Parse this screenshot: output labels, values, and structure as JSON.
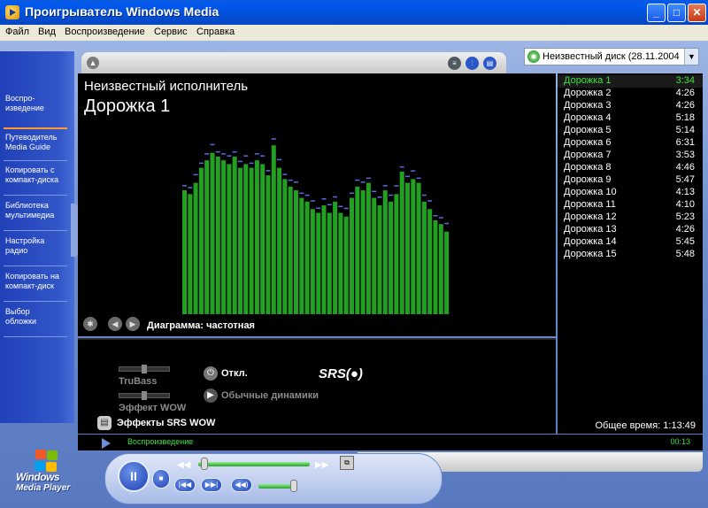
{
  "window": {
    "title": "Проигрыватель Windows Media",
    "minimize_icon": "minimize-icon",
    "maximize_icon": "maximize-icon",
    "close_icon": "close-icon"
  },
  "menu": [
    {
      "label": "Файл"
    },
    {
      "label": "Вид"
    },
    {
      "label": "Воспроизведение"
    },
    {
      "label": "Сервис"
    },
    {
      "label": "Справка"
    }
  ],
  "taskbar": [
    {
      "label": "Воспро-\nизведение",
      "active": true
    },
    {
      "label": "Путеводитель\nMedia Guide"
    },
    {
      "label": "Копировать с\nкомпакт-диска"
    },
    {
      "label": "Библиотека\nмультимедиа"
    },
    {
      "label": "Настройка\nрадио"
    },
    {
      "label": "Копировать на\nкомпакт-диск"
    },
    {
      "label": "Выбор\nобложки"
    }
  ],
  "cd_select": {
    "value": "Неизвестный диск (28.11.2004"
  },
  "now_playing": {
    "artist": "Неизвестный исполнитель",
    "track": "Дорожка 1",
    "viz_label": "Диаграмма: частотная",
    "spectrum": [
      0.66,
      0.64,
      0.7,
      0.78,
      0.82,
      0.86,
      0.84,
      0.82,
      0.8,
      0.84,
      0.78,
      0.8,
      0.78,
      0.82,
      0.8,
      0.74,
      0.9,
      0.78,
      0.72,
      0.68,
      0.66,
      0.62,
      0.6,
      0.56,
      0.54,
      0.58,
      0.54,
      0.6,
      0.54,
      0.52,
      0.62,
      0.68,
      0.66,
      0.7,
      0.62,
      0.58,
      0.66,
      0.6,
      0.64,
      0.76,
      0.7,
      0.72,
      0.7,
      0.6,
      0.56,
      0.5,
      0.48,
      0.44
    ]
  },
  "srs": {
    "trubass": "TruBass",
    "wow_effect": "Эффект WOW",
    "off": "Откл.",
    "logo": "SRS(●)",
    "speakers": "Обычные динамики",
    "effects": "Эффекты SRS WOW"
  },
  "playlist": {
    "tracks": [
      {
        "name": "Дорожка 1",
        "time": "3:34"
      },
      {
        "name": "Дорожка 2",
        "time": "4:26"
      },
      {
        "name": "Дорожка 3",
        "time": "4:26"
      },
      {
        "name": "Дорожка 4",
        "time": "5:18"
      },
      {
        "name": "Дорожка 5",
        "time": "5:14"
      },
      {
        "name": "Дорожка 6",
        "time": "6:31"
      },
      {
        "name": "Дорожка 7",
        "time": "3:53"
      },
      {
        "name": "Дорожка 8",
        "time": "4:46"
      },
      {
        "name": "Дорожка 9",
        "time": "5:47"
      },
      {
        "name": "Дорожка 10",
        "time": "4:13"
      },
      {
        "name": "Дорожка 11",
        "time": "4:10"
      },
      {
        "name": "Дорожка 12",
        "time": "5:23"
      },
      {
        "name": "Дорожка 13",
        "time": "4:26"
      },
      {
        "name": "Дорожка 14",
        "time": "5:45"
      },
      {
        "name": "Дорожка 15",
        "time": "5:48"
      }
    ],
    "total": "Общее время: 1:13:49"
  },
  "status": {
    "text": "Воспроизведение",
    "time": "00:13"
  },
  "logo": {
    "line1": "Windows",
    "line2": "Media Player"
  },
  "controls": {
    "play": "II",
    "stop": "■",
    "prev": "|◀◀",
    "next": "▶▶|",
    "mute": "◀◀)"
  },
  "progress": {
    "seek_fraction": 0.02,
    "volume_fraction": 0.85
  }
}
